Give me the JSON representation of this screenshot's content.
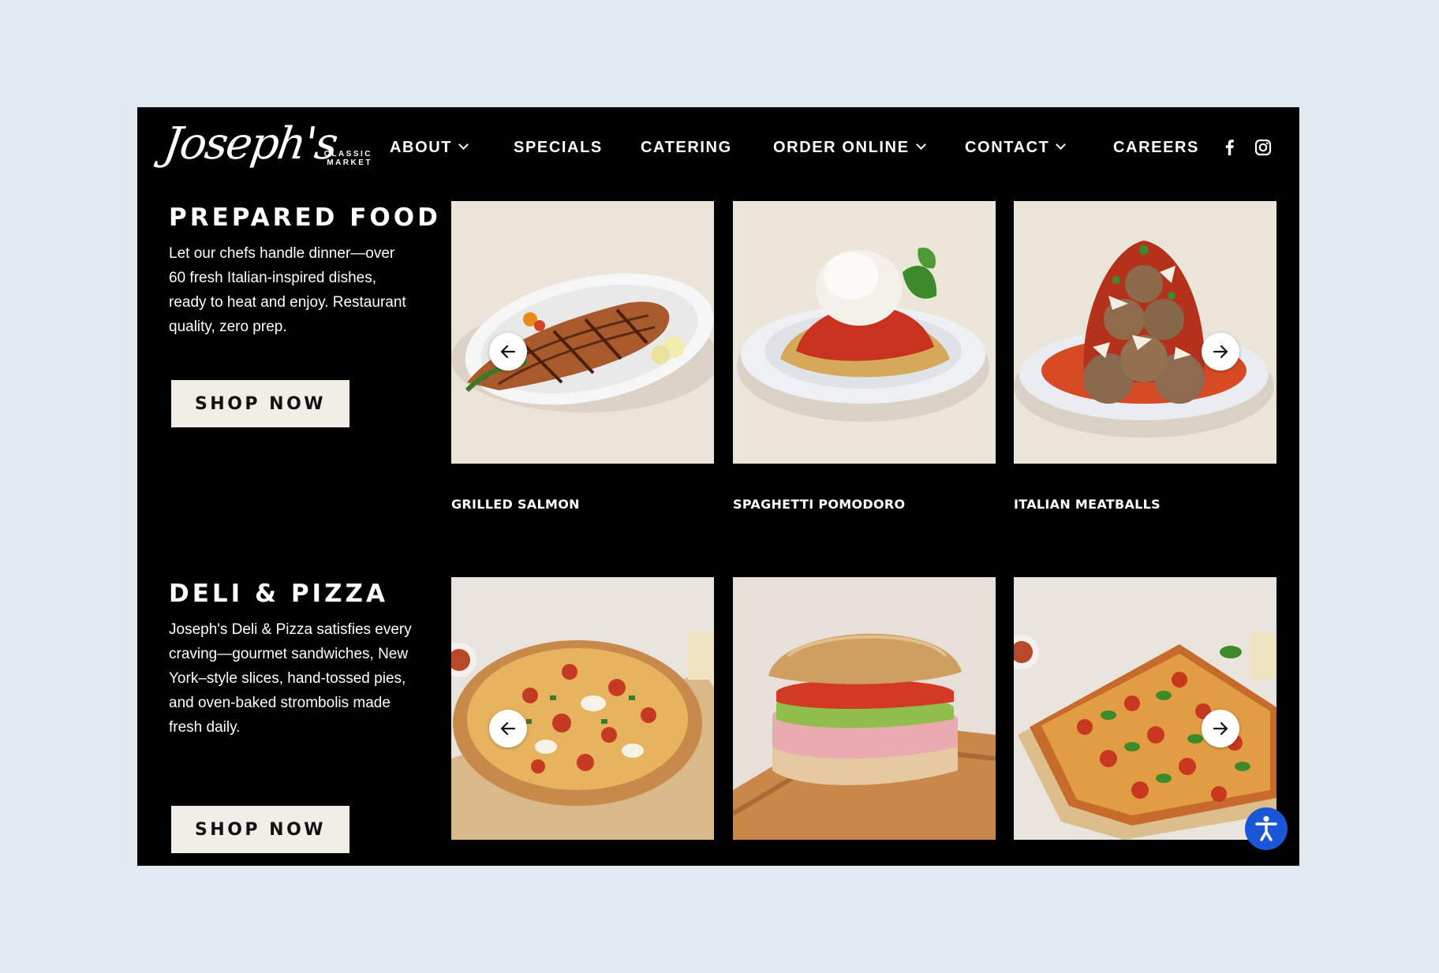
{
  "brand": {
    "script_name": "Joseph's",
    "subtitle_line1": "CLASSIC",
    "subtitle_line2": "MARKET"
  },
  "nav": {
    "items": [
      {
        "label": "ABOUT",
        "has_dropdown": true
      },
      {
        "label": "SPECIALS",
        "has_dropdown": false
      },
      {
        "label": "CATERING",
        "has_dropdown": false
      },
      {
        "label": "ORDER ONLINE",
        "has_dropdown": true
      },
      {
        "label": "CONTACT",
        "has_dropdown": true
      },
      {
        "label": "CAREERS",
        "has_dropdown": false
      }
    ],
    "social_icons": [
      "facebook-icon",
      "instagram-icon"
    ]
  },
  "sections": [
    {
      "title": "PREPARED FOOD",
      "description": "Let our chefs handle dinner—over 60 fresh Italian-inspired dishes, ready to heat and enjoy. Restaurant quality, zero prep.",
      "button": "SHOP NOW",
      "items": [
        {
          "label": "GRILLED SALMON",
          "image": "grilled-salmon-image"
        },
        {
          "label": "SPAGHETTI POMODORO",
          "image": "spaghetti-pomodoro-image"
        },
        {
          "label": "ITALIAN MEATBALLS",
          "image": "italian-meatballs-image"
        }
      ]
    },
    {
      "title": "DELI & PIZZA",
      "description": "Joseph's Deli & Pizza satisfies every craving—gourmet sandwiches, New York–style slices, hand-tossed pies, and oven-baked strombolis made fresh daily.",
      "button": "SHOP NOW",
      "items": [
        {
          "label": "",
          "image": "round-pizza-image"
        },
        {
          "label": "",
          "image": "deli-sandwich-image"
        },
        {
          "label": "",
          "image": "square-pizza-image"
        }
      ]
    }
  ],
  "colors": {
    "page_background": "#e3e9f3",
    "site_background": "#000000",
    "button_background": "#f1eee7",
    "accessibility_blue": "#1b56d6"
  }
}
